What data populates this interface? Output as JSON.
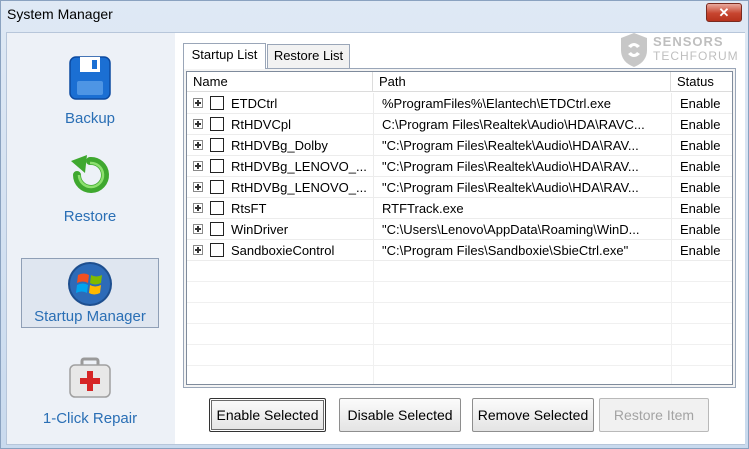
{
  "window": {
    "title": "System Manager",
    "close_label": "✕"
  },
  "sidebar": {
    "items": [
      {
        "label": "Backup",
        "icon": "floppy-disk-icon",
        "active": false
      },
      {
        "label": "Restore",
        "icon": "restore-arrow-icon",
        "active": false
      },
      {
        "label": "Startup Manager",
        "icon": "windows-logo-icon",
        "active": true
      },
      {
        "label": "1-Click Repair",
        "icon": "first-aid-kit-icon",
        "active": false
      }
    ]
  },
  "tabs": [
    {
      "label": "Startup List",
      "active": true
    },
    {
      "label": "Restore List",
      "active": false
    }
  ],
  "table": {
    "columns": [
      "Name",
      "Path",
      "Status"
    ],
    "rows": [
      {
        "name": "ETDCtrl",
        "path": "%ProgramFiles%\\Elantech\\ETDCtrl.exe",
        "status": "Enable",
        "checked": false
      },
      {
        "name": "RtHDVCpl",
        "path": "C:\\Program Files\\Realtek\\Audio\\HDA\\RAVC...",
        "status": "Enable",
        "checked": false
      },
      {
        "name": "RtHDVBg_Dolby",
        "path": "\"C:\\Program Files\\Realtek\\Audio\\HDA\\RAV...",
        "status": "Enable",
        "checked": false
      },
      {
        "name": "RtHDVBg_LENOVO_...",
        "path": "\"C:\\Program Files\\Realtek\\Audio\\HDA\\RAV...",
        "status": "Enable",
        "checked": false
      },
      {
        "name": "RtHDVBg_LENOVO_...",
        "path": "\"C:\\Program Files\\Realtek\\Audio\\HDA\\RAV...",
        "status": "Enable",
        "checked": false
      },
      {
        "name": "RtsFT",
        "path": "RTFTrack.exe",
        "status": "Enable",
        "checked": false
      },
      {
        "name": "WinDriver",
        "path": "\"C:\\Users\\Lenovo\\AppData\\Roaming\\WinD...",
        "status": "Enable",
        "checked": false
      },
      {
        "name": "SandboxieControl",
        "path": "\"C:\\Program Files\\Sandboxie\\SbieCtrl.exe\"",
        "status": "Enable",
        "checked": false
      }
    ]
  },
  "buttons": {
    "enable_selected": "Enable Selected",
    "disable_selected": "Disable Selected",
    "remove_selected": "Remove Selected",
    "restore_item": "Restore Item"
  },
  "watermark": {
    "line1": "SENSORS",
    "line2": "TECHFORUM"
  },
  "colors": {
    "accent": "#2a6fb5",
    "title_bar": "#dfe9f5",
    "close": "#c7452f"
  }
}
